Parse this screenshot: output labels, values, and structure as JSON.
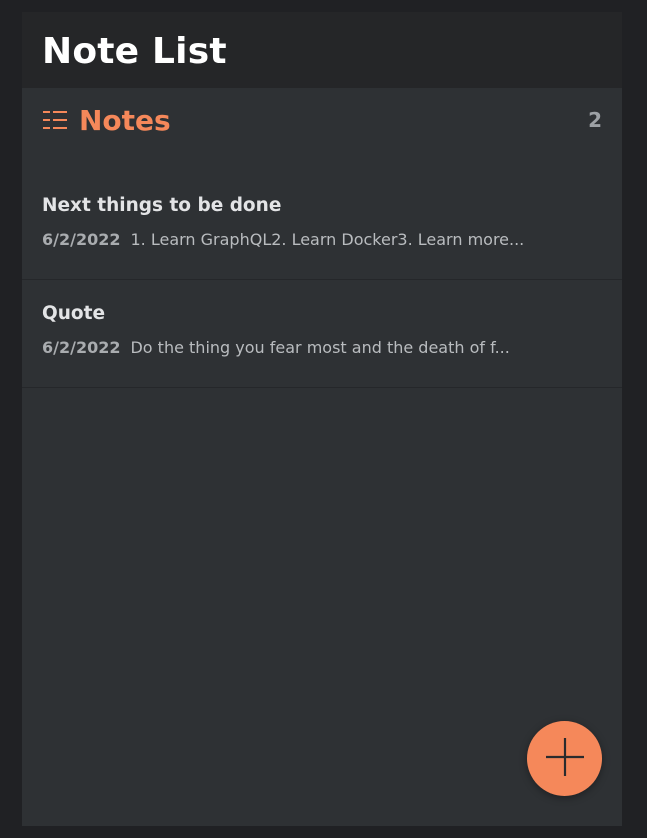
{
  "header": {
    "title": "Note List"
  },
  "notes_section": {
    "title": "Notes",
    "count": "2",
    "icon": "list-icon"
  },
  "notes": [
    {
      "title": "Next things to be done",
      "date": "6/2/2022",
      "preview": "1. Learn GraphQL2. Learn Docker3. Learn more..."
    },
    {
      "title": "Quote",
      "date": "6/2/2022",
      "preview": "Do the thing you fear most and the death of f..."
    }
  ],
  "fab": {
    "icon": "plus-icon"
  },
  "colors": {
    "accent": "#f5885a",
    "background": "#2e3134",
    "header_background": "#252628"
  }
}
